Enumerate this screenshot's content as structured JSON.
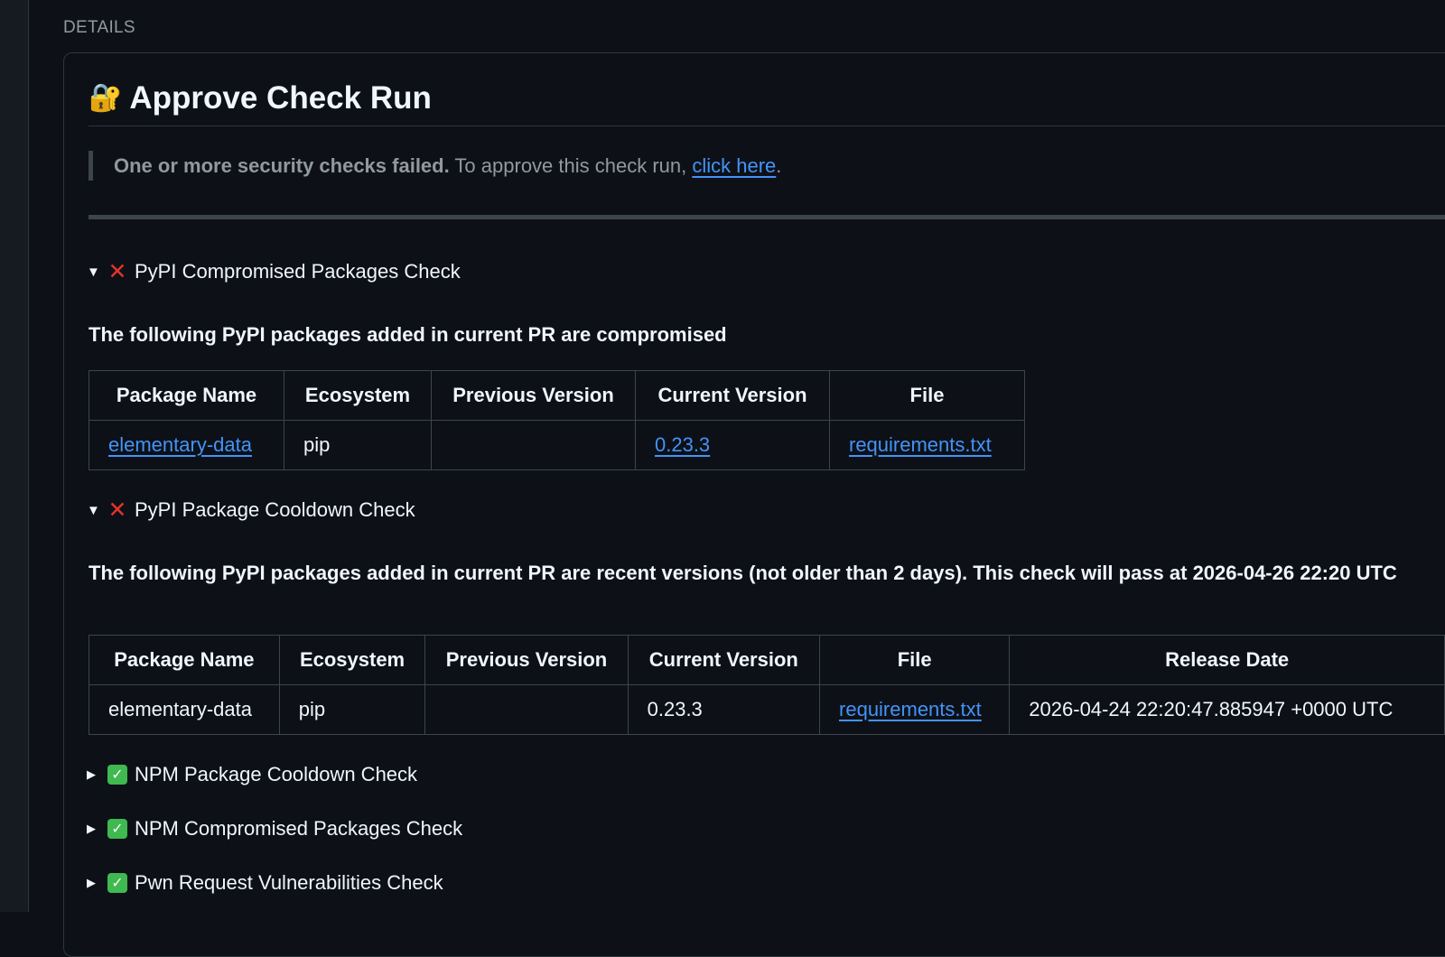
{
  "section_label": "DETAILS",
  "title": {
    "icon": "🔐",
    "text": "Approve Check Run"
  },
  "notice": {
    "bold": "One or more security checks failed.",
    "text": " To approve this check run, ",
    "link": "click here",
    "end": "."
  },
  "checks": [
    {
      "caret": "▼",
      "icon": "❌",
      "status": "failed",
      "label": "PyPI Compromised Packages Check",
      "description": "The following PyPI packages added in current PR are compromised",
      "table": {
        "headers": [
          "Package Name",
          "Ecosystem",
          "Previous Version",
          "Current Version",
          "File"
        ],
        "row": {
          "package": "elementary-data",
          "ecosystem": "pip",
          "previous": "",
          "current": "0.23.3",
          "file": "requirements.txt"
        }
      }
    },
    {
      "caret": "▼",
      "icon": "❌",
      "status": "failed",
      "label": "PyPI Package Cooldown Check",
      "description": "The following PyPI packages added in current PR are recent versions (not older than 2 days). This check will pass at 2026-04-26 22:20 UTC",
      "table": {
        "headers": [
          "Package Name",
          "Ecosystem",
          "Previous Version",
          "Current Version",
          "File",
          "Release Date"
        ],
        "row": {
          "package": "elementary-data",
          "ecosystem": "pip",
          "previous": "",
          "current": "0.23.3",
          "file": "requirements.txt",
          "release_date": "2026-04-24 22:20:47.885947 +0000 UTC"
        }
      }
    },
    {
      "caret": "▶",
      "icon": "✓",
      "status": "passed",
      "label": "NPM Package Cooldown Check"
    },
    {
      "caret": "▶",
      "icon": "✓",
      "status": "passed",
      "label": "NPM Compromised Packages Check"
    },
    {
      "caret": "▶",
      "icon": "✓",
      "status": "passed",
      "label": "Pwn Request Vulnerabilities Check"
    }
  ],
  "colors": {
    "background": "#0d1117",
    "border": "#30363d",
    "link": "#4493f8",
    "fail": "#e5332a",
    "pass": "#3fb950"
  }
}
